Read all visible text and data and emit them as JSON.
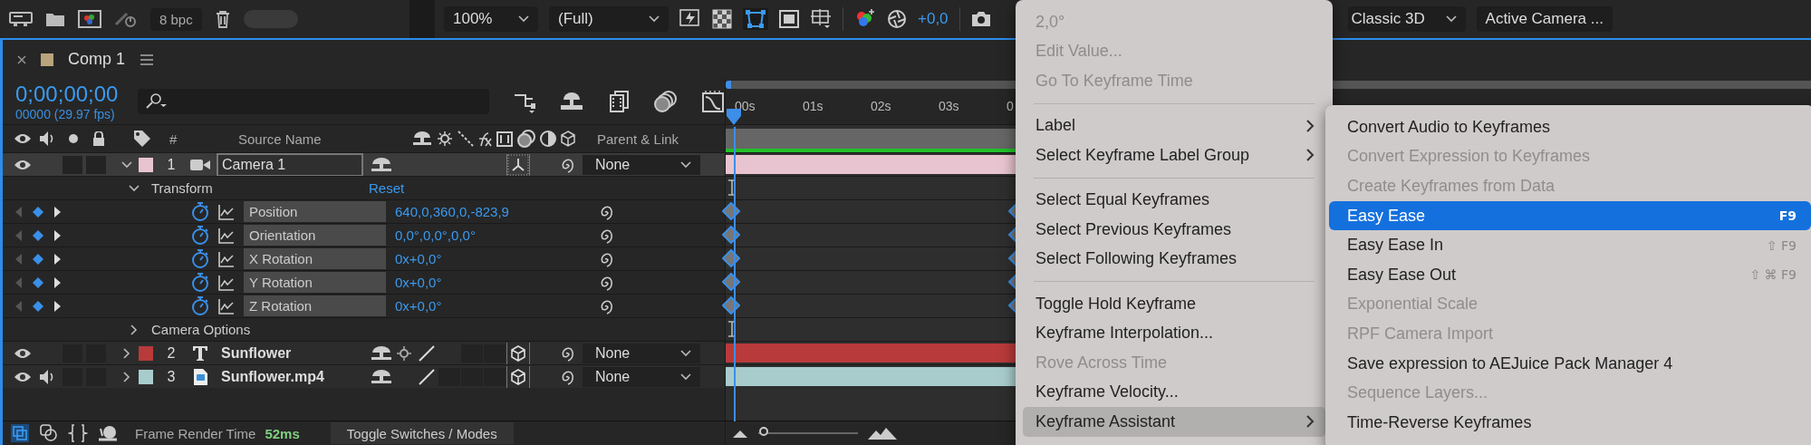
{
  "top_bar": {
    "bit_depth": "8 bpc",
    "zoom": "100%",
    "resolution": "(Full)",
    "exposure": "+0,0",
    "renderer": "Classic 3D",
    "view": "Active Camera ..."
  },
  "comp": {
    "title": "Comp 1",
    "timecode": "0;00;00;00",
    "frame_info": "00000 (29.97 fps)"
  },
  "columns": {
    "number": "#",
    "source_name": "Source Name",
    "parent": "Parent & Link"
  },
  "layers": [
    {
      "number": "1",
      "name": "Camera 1",
      "kind": "camera",
      "color": "#e8c4d0",
      "selected": true,
      "expanded": true,
      "audio": false,
      "solo": false,
      "locked": false,
      "parent": "None",
      "groups": [
        {
          "label": "Transform",
          "action": "Reset",
          "expanded": true,
          "properties": [
            {
              "name": "Position",
              "value": "640,0,360,0,-823,9"
            },
            {
              "name": "Orientation",
              "value": "0,0°,0,0°,0,0°"
            },
            {
              "name": "X Rotation",
              "value": "0x+0,0°"
            },
            {
              "name": "Y Rotation",
              "value": "0x+0,0°"
            },
            {
              "name": "Z Rotation",
              "value": "0x+0,0°"
            }
          ]
        },
        {
          "label": "Camera Options",
          "expanded": false
        }
      ]
    },
    {
      "number": "2",
      "name": "Sunflower",
      "kind": "text",
      "color": "#b83a3a",
      "selected": false,
      "expanded": false,
      "audio": false,
      "solo": false,
      "locked": false,
      "parent": "None"
    },
    {
      "number": "3",
      "name": "Sunflower.mp4",
      "kind": "footage",
      "color": "#a8cccc",
      "selected": false,
      "expanded": false,
      "audio": true,
      "solo": false,
      "locked": false,
      "parent": "None"
    }
  ],
  "timeline_zoom": {
    "level": 0.05
  },
  "ruler": [
    "00s",
    "01s",
    "02s",
    "03s",
    "0"
  ],
  "status_bar": {
    "label": "Frame Render Time",
    "value": "52ms",
    "toggle": "Toggle Switches / Modes"
  },
  "context_menu": {
    "items": [
      {
        "kind": "item",
        "label": "2,0°",
        "disabled": true,
        "submenu": false,
        "highlighted": false
      },
      {
        "kind": "item",
        "label": "Edit Value...",
        "disabled": true,
        "submenu": false,
        "highlighted": false
      },
      {
        "kind": "item",
        "label": "Go To Keyframe Time",
        "disabled": true,
        "submenu": false,
        "highlighted": false
      },
      {
        "kind": "separator"
      },
      {
        "kind": "item",
        "label": "Label",
        "disabled": false,
        "submenu": true,
        "highlighted": false
      },
      {
        "kind": "item",
        "label": "Select Keyframe Label Group",
        "disabled": false,
        "submenu": true,
        "highlighted": false
      },
      {
        "kind": "separator"
      },
      {
        "kind": "item",
        "label": "Select Equal Keyframes",
        "disabled": false,
        "submenu": false,
        "highlighted": false
      },
      {
        "kind": "item",
        "label": "Select Previous Keyframes",
        "disabled": false,
        "submenu": false,
        "highlighted": false
      },
      {
        "kind": "item",
        "label": "Select Following Keyframes",
        "disabled": false,
        "submenu": false,
        "highlighted": false
      },
      {
        "kind": "separator"
      },
      {
        "kind": "item",
        "label": "Toggle Hold Keyframe",
        "disabled": false,
        "submenu": false,
        "highlighted": false
      },
      {
        "kind": "item",
        "label": "Keyframe Interpolation...",
        "disabled": false,
        "submenu": false,
        "highlighted": false
      },
      {
        "kind": "item",
        "label": "Rove Across Time",
        "disabled": true,
        "submenu": false,
        "highlighted": false
      },
      {
        "kind": "item",
        "label": "Keyframe Velocity...",
        "disabled": false,
        "submenu": false,
        "highlighted": false
      },
      {
        "kind": "item",
        "label": "Keyframe Assistant",
        "disabled": false,
        "submenu": true,
        "highlighted": true
      }
    ]
  },
  "submenu": {
    "items": [
      {
        "label": "Convert Audio to Keyframes",
        "disabled": false,
        "selected": false
      },
      {
        "label": "Convert Expression to Keyframes",
        "disabled": true,
        "selected": false
      },
      {
        "label": "Create Keyframes from Data",
        "disabled": true,
        "selected": false
      },
      {
        "label": "Easy Ease",
        "disabled": false,
        "selected": true,
        "shortcut": "F9"
      },
      {
        "label": "Easy Ease In",
        "disabled": false,
        "selected": false,
        "shortcut": "⇧ F9"
      },
      {
        "label": "Easy Ease Out",
        "disabled": false,
        "selected": false,
        "shortcut": "⇧ ⌘ F9"
      },
      {
        "label": "Exponential Scale",
        "disabled": true,
        "selected": false
      },
      {
        "label": "RPF Camera Import",
        "disabled": true,
        "selected": false
      },
      {
        "label": "Save expression to AEJuice Pack Manager 4",
        "disabled": false,
        "selected": false
      },
      {
        "label": "Sequence Layers...",
        "disabled": true,
        "selected": false
      },
      {
        "label": "Time-Reverse Keyframes",
        "disabled": false,
        "selected": false
      }
    ]
  }
}
